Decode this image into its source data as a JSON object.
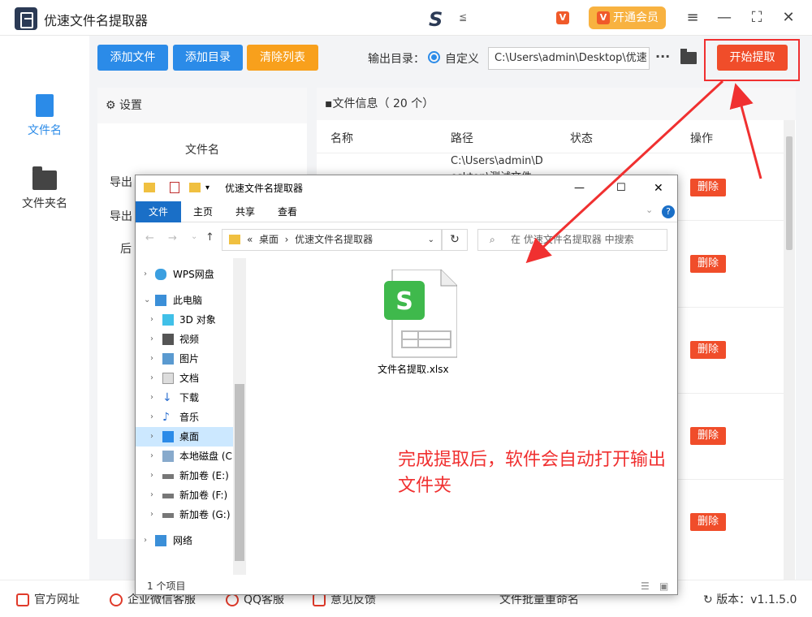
{
  "app": {
    "title": "优速文件名提取器",
    "vip_label": "开通会员",
    "vip_icon": "V",
    "s_dots": "≦"
  },
  "window_controls": {
    "menu": "≡",
    "minimize": "—",
    "maximize": "⛶",
    "close": "✕"
  },
  "sidebar": {
    "items": [
      {
        "label": "文件名",
        "icon": "file-icon"
      },
      {
        "label": "文件夹名",
        "icon": "folder-icon"
      }
    ]
  },
  "toolbar": {
    "add_file": "添加文件",
    "add_dir": "添加目录",
    "clear_list": "清除列表",
    "output_dir_label": "输出目录：",
    "radio_label": "自定义",
    "path_value": "C:\\Users\\admin\\Desktop\\优速",
    "more": "···",
    "start": "开始提取"
  },
  "settings": {
    "title": "设置",
    "subtitle": "文件名",
    "rows": [
      "导出",
      "导出",
      "后"
    ]
  },
  "file_info": {
    "title": "文件信息（ 20 个）",
    "columns": [
      "名称",
      "路径",
      "状态",
      "操作"
    ],
    "path_line1": "C:\\Users\\admin\\D",
    "path_line2": "esktop\\测试文件",
    "delete": "删除"
  },
  "footer": {
    "items": [
      "官方网址",
      "企业微信客服",
      "QQ客服",
      "意见反馈",
      "文件批量重命名"
    ],
    "version": "版本：v1.1.5.0"
  },
  "explorer": {
    "title": "优速文件名提取器",
    "tabs": [
      "文件",
      "主页",
      "共享",
      "查看"
    ],
    "breadcrumb": {
      "prefix": "«",
      "root": "桌面",
      "sep": "›",
      "current": "优速文件名提取器"
    },
    "search_placeholder": "在 优速文件名提取器 中搜索",
    "nav": [
      "WPS网盘",
      "此电脑",
      "3D 对象",
      "视频",
      "图片",
      "文档",
      "下载",
      "音乐",
      "桌面",
      "本地磁盘 (C:",
      "新加卷 (E:)",
      "新加卷 (F:)",
      "新加卷 (G:)",
      "网络"
    ],
    "file": {
      "name": "文件名提取.xlsx",
      "badge": "S"
    },
    "status": "1 个项目"
  },
  "annotation": "完成提取后，软件会自动打开输出文件夹",
  "colors": {
    "blue": "#2b8be8",
    "orange": "#f8a01c",
    "red": "#f04d2a",
    "annotation": "#f03030"
  }
}
